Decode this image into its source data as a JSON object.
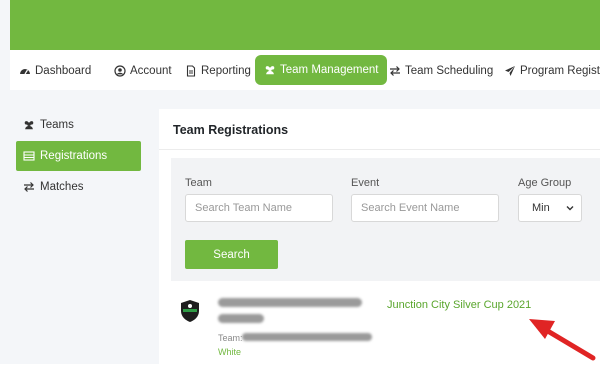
{
  "nav": {
    "dashboard": "Dashboard",
    "account": "Account",
    "reporting": "Reporting",
    "team_management": "Team Management",
    "team_scheduling": "Team Scheduling",
    "program_registration": "Program Registrat"
  },
  "sidebar": {
    "items": [
      {
        "label": "Teams",
        "icon": "users-icon"
      },
      {
        "label": "Registrations",
        "icon": "list-icon"
      },
      {
        "label": "Matches",
        "icon": "swap-arrows-icon"
      }
    ]
  },
  "main": {
    "title": "Team Registrations",
    "filters": {
      "team_label": "Team",
      "team_placeholder": "Search Team Name",
      "event_label": "Event",
      "event_placeholder": "Search Event Name",
      "age_label": "Age Group",
      "age_value": "Min",
      "search_button": "Search"
    },
    "result": {
      "team_prefix": "Team:",
      "color_text": "White",
      "event_name": "Junction City Silver Cup 2021"
    }
  },
  "colors": {
    "brand_green": "#72b840",
    "annotation_arrow": "#e02424"
  }
}
